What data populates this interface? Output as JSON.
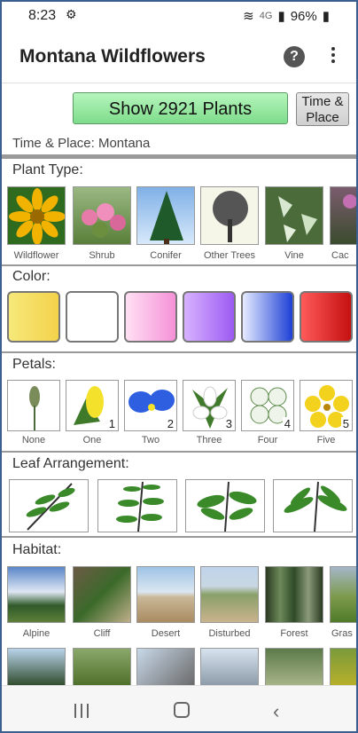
{
  "status": {
    "time": "8:23",
    "battery": "96%",
    "signal_label": "4G"
  },
  "app": {
    "title": "Montana Wildflowers"
  },
  "actions": {
    "show_plants": "Show 2921 Plants",
    "time_place": [
      "Time &",
      "Place"
    ]
  },
  "time_place_line": "Time & Place: Montana",
  "sections": {
    "plant_type": "Plant Type:",
    "color": "Color:",
    "petals": "Petals:",
    "leaf": "Leaf Arrangement:",
    "habitat": "Habitat:"
  },
  "plant_types": [
    {
      "label": "Wildflower",
      "icon": "sunflower-image"
    },
    {
      "label": "Shrub",
      "icon": "shrub-image"
    },
    {
      "label": "Conifer",
      "icon": "conifer-image"
    },
    {
      "label": "Other Trees",
      "icon": "tree-image"
    },
    {
      "label": "Vine",
      "icon": "vine-image"
    },
    {
      "label": "Cac",
      "icon": "cactus-image"
    }
  ],
  "colors": [
    {
      "name": "yellow",
      "from": "#fff27a",
      "to": "#f6d44c"
    },
    {
      "name": "white",
      "from": "#ffffff",
      "to": "#ffffff"
    },
    {
      "name": "pink",
      "from": "#ffd6f0",
      "to": "#f58fd6"
    },
    {
      "name": "purple",
      "from": "#d7a8ff",
      "to": "#9b5cf0"
    },
    {
      "name": "blue",
      "from": "#e0e6ff",
      "to": "#1f45d8"
    },
    {
      "name": "red",
      "from": "#ff6a6a",
      "to": "#c81212"
    }
  ],
  "petals": [
    {
      "label": "None",
      "num": ""
    },
    {
      "label": "One",
      "num": "1"
    },
    {
      "label": "Two",
      "num": "2"
    },
    {
      "label": "Three",
      "num": "3"
    },
    {
      "label": "Four",
      "num": "4"
    },
    {
      "label": "Five",
      "num": "5"
    }
  ],
  "leaf_arrangements": [
    "alternate",
    "opposite",
    "whorled",
    "basal"
  ],
  "habitats": [
    {
      "label": "Alpine"
    },
    {
      "label": "Cliff"
    },
    {
      "label": "Desert"
    },
    {
      "label": "Disturbed"
    },
    {
      "label": "Forest"
    },
    {
      "label": "Gras"
    }
  ]
}
